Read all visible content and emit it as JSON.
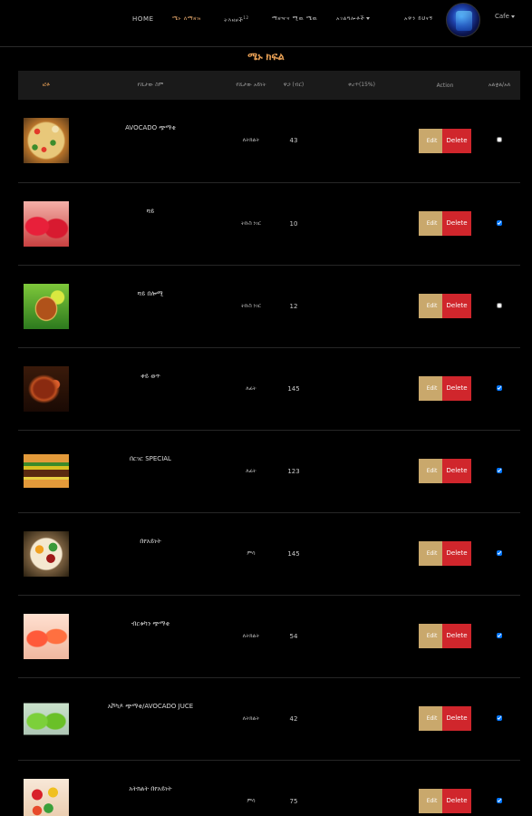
{
  "nav": {
    "home": "HOME",
    "menu": "ሜኑ ለማዘዝ",
    "orders": "ትእዛዞች",
    "orders_count": "12",
    "add_menu": "ማዘዣና ሚዉ ሜዉ",
    "settings": "አገልግሎቶች",
    "logout": "አዋን ይህናኝ",
    "cafe": "Cafe"
  },
  "page": {
    "title": "ሜኑ ክፍል"
  },
  "table": {
    "headers": [
      "ፎቶ",
      "የሺታው ስም",
      "የሺታው አይነት",
      "ዋጋ (ብር)",
      "ቀረጥ(15%)",
      "Action",
      "አልቋል/አለ"
    ],
    "edit_label": "Edit",
    "delete_label": "Delete",
    "rows": [
      {
        "name": "AVOCADO ጭማቂ",
        "type": "ለትክልት",
        "price": "43",
        "tax": "",
        "available": false,
        "image": "pizza"
      },
      {
        "name": "ሻይ",
        "type": "ትኩስ ነገር",
        "price": "10",
        "tax": "",
        "available": true,
        "image": "tea-red"
      },
      {
        "name": "ሻይ በሎሚ",
        "type": "ትኩስ ነገር",
        "price": "12",
        "tax": "",
        "available": false,
        "image": "tea-lemon"
      },
      {
        "name": "ቀይ ወጥ",
        "type": "ለፊት",
        "price": "145",
        "tax": "",
        "available": true,
        "image": "stew"
      },
      {
        "name": "በርገር SPECIAL",
        "type": "ለፊት",
        "price": "123",
        "tax": "",
        "available": true,
        "image": "burger"
      },
      {
        "name": "በየአይነት",
        "type": "ምሳ",
        "price": "145",
        "tax": "",
        "available": true,
        "image": "mixed-plate"
      },
      {
        "name": "ብርቱካን ጭማቂ",
        "type": "ለትክልት",
        "price": "54",
        "tax": "",
        "available": true,
        "image": "orange-juice"
      },
      {
        "name": "አቮካዶ ጭማቂ/AVOCADO JUCE",
        "type": "ለትክልት",
        "price": "42",
        "tax": "",
        "available": true,
        "image": "avocado-juice"
      },
      {
        "name": "አትክልት በየአይነት",
        "type": "ምሳ",
        "price": "75",
        "tax": "",
        "available": true,
        "image": "veg-plate"
      }
    ]
  }
}
